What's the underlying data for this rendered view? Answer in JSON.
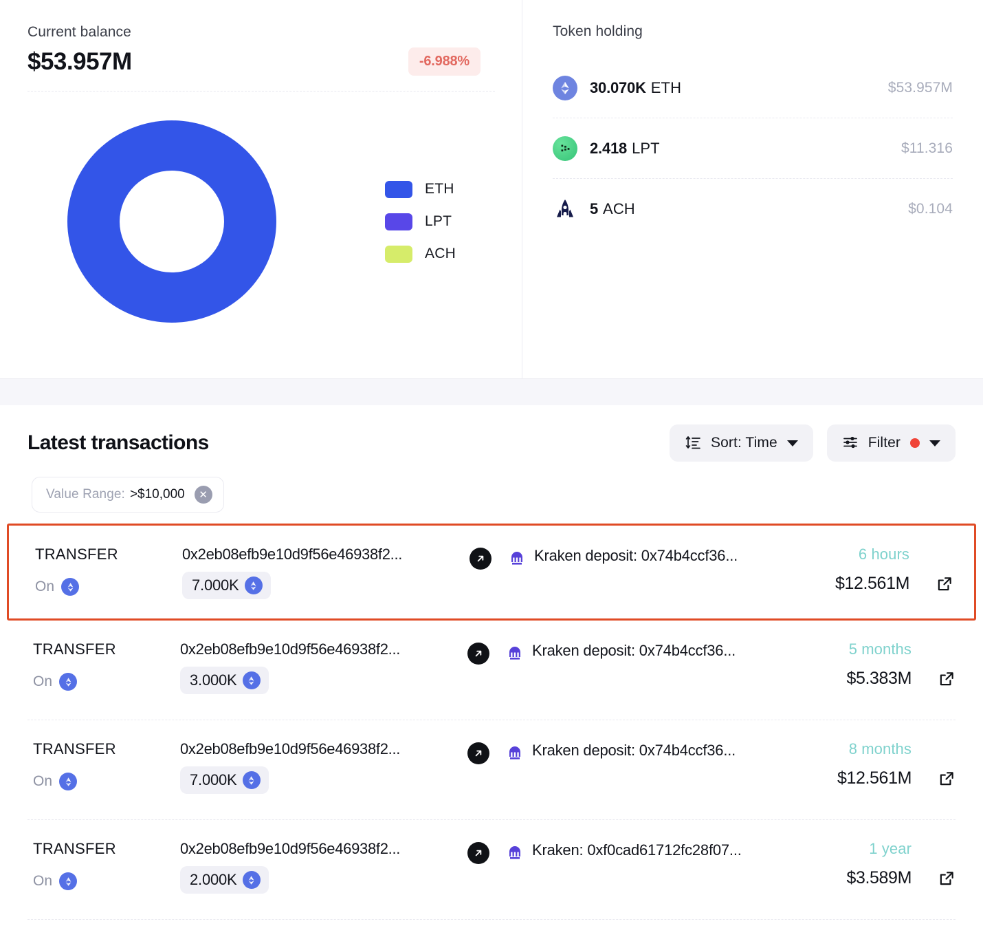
{
  "balance_panel": {
    "label": "Current balance",
    "amount": "$53.957M",
    "delta": "-6.988%",
    "delta_color": "#e2685f",
    "delta_bg": "#fdeceb"
  },
  "chart_data": {
    "type": "pie",
    "title": "Current balance",
    "subtitle": "",
    "variant": "donut",
    "legend_position": "right",
    "categories": [
      "ETH",
      "LPT",
      "ACH"
    ],
    "values": [
      53957000,
      11.316,
      0.104
    ],
    "percentages": [
      99.99996,
      2e-05,
      2e-07
    ],
    "colors": [
      "#3355e8",
      "#5847e8",
      "#d6ec6a"
    ],
    "labels": [
      "ETH",
      "LPT",
      "ACH"
    ],
    "value_unit": "USD",
    "xlabel": "",
    "ylabel": ""
  },
  "tokens_panel": {
    "title": "Token holding",
    "rows": [
      {
        "icon": "eth-token-icon",
        "amount": "30.070K",
        "symbol": "ETH",
        "value": "$53.957M"
      },
      {
        "icon": "lpt-token-icon",
        "amount": "2.418",
        "symbol": "LPT",
        "value": "$11.316"
      },
      {
        "icon": "ach-token-icon",
        "amount": "5",
        "symbol": "ACH",
        "value": "$0.104"
      }
    ]
  },
  "transactions": {
    "title": "Latest transactions",
    "sort_label": "Sort: Time",
    "filter_label": "Filter",
    "filter_active_color": "#f04438",
    "chip": {
      "key": "Value Range:",
      "value": ">$10,000",
      "remove_label": "✕"
    },
    "rows": [
      {
        "type": "TRANSFER",
        "on_label": "On",
        "chain": "ethereum",
        "hash": "0x2eb08efb9e10d9f56e46938f2...",
        "amount": "7.000K",
        "destination": "Kraken deposit: 0x74b4ccf36...",
        "time": "6 hours",
        "usd": "$12.561M",
        "highlighted": true
      },
      {
        "type": "TRANSFER",
        "on_label": "On",
        "chain": "ethereum",
        "hash": "0x2eb08efb9e10d9f56e46938f2...",
        "amount": "3.000K",
        "destination": "Kraken deposit: 0x74b4ccf36...",
        "time": "5 months",
        "usd": "$5.383M",
        "highlighted": false
      },
      {
        "type": "TRANSFER",
        "on_label": "On",
        "chain": "ethereum",
        "hash": "0x2eb08efb9e10d9f56e46938f2...",
        "amount": "7.000K",
        "destination": "Kraken deposit: 0x74b4ccf36...",
        "time": "8 months",
        "usd": "$12.561M",
        "highlighted": false
      },
      {
        "type": "TRANSFER",
        "on_label": "On",
        "chain": "ethereum",
        "hash": "0x2eb08efb9e10d9f56e46938f2...",
        "amount": "2.000K",
        "destination": "Kraken: 0xf0cad61712fc28f07...",
        "time": "1 year",
        "usd": "$3.589M",
        "highlighted": false
      }
    ]
  }
}
